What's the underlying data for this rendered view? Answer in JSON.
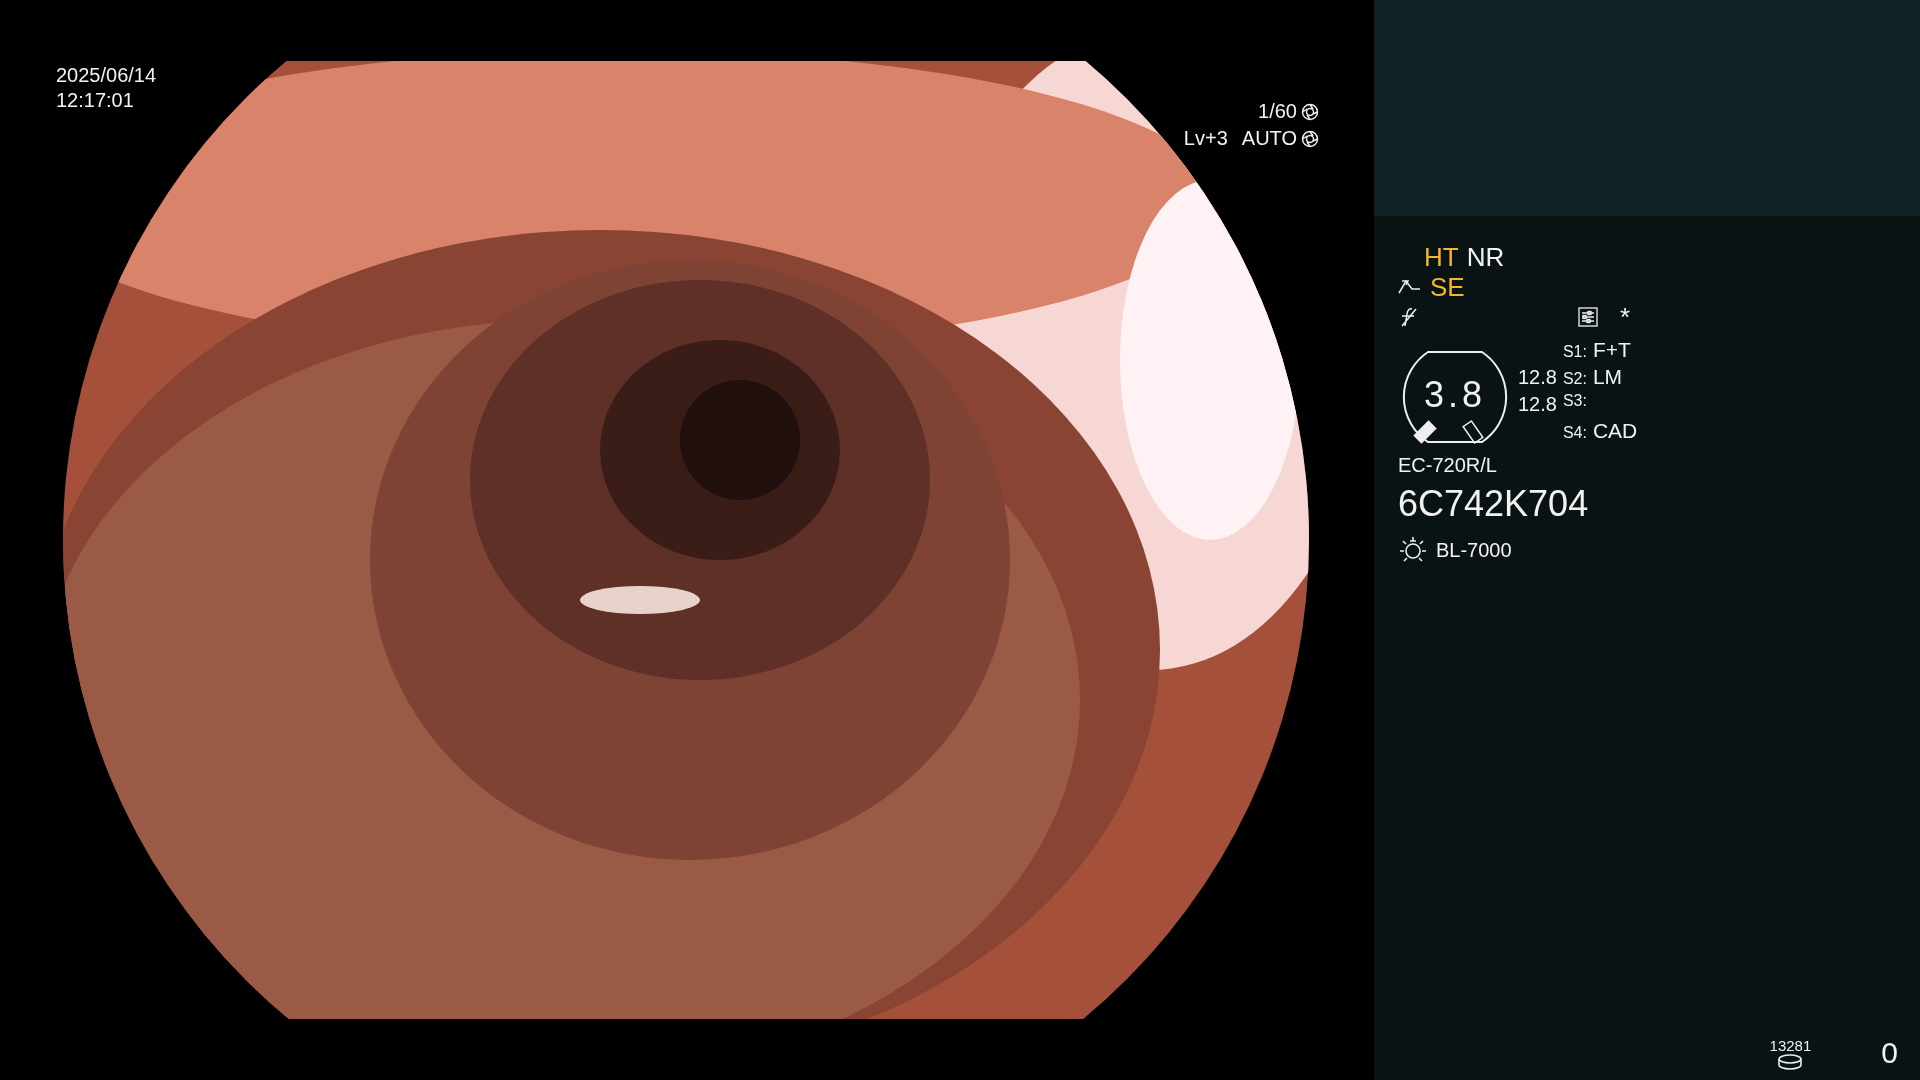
{
  "timestamp": {
    "date": "2025/06/14",
    "time": "12:17:01"
  },
  "exposure": {
    "shutter": "1/60",
    "level": "Lv+3",
    "mode": "AUTO"
  },
  "modes": [
    {
      "label": "HT",
      "on": true
    },
    {
      "label": "NR",
      "on": false
    }
  ],
  "structure_enhancement": {
    "label": "SE",
    "on": true
  },
  "asterisk": "*",
  "gauge": {
    "value": "3.8",
    "markers": [
      {
        "filled": true
      },
      {
        "filled": false
      }
    ],
    "readings": [
      "12.8",
      "12.8"
    ]
  },
  "switches": [
    {
      "label": "S1:",
      "value": "F+T"
    },
    {
      "label": "S2:",
      "value": "LM"
    },
    {
      "label": "S3:"
    },
    {
      "label": "S4:",
      "value": "CAD"
    }
  ],
  "scope": {
    "model": "EC-720R/L",
    "serial": "6C742K704"
  },
  "light_source": "BL-7000",
  "storage": {
    "count": "13281"
  },
  "counter": "0"
}
